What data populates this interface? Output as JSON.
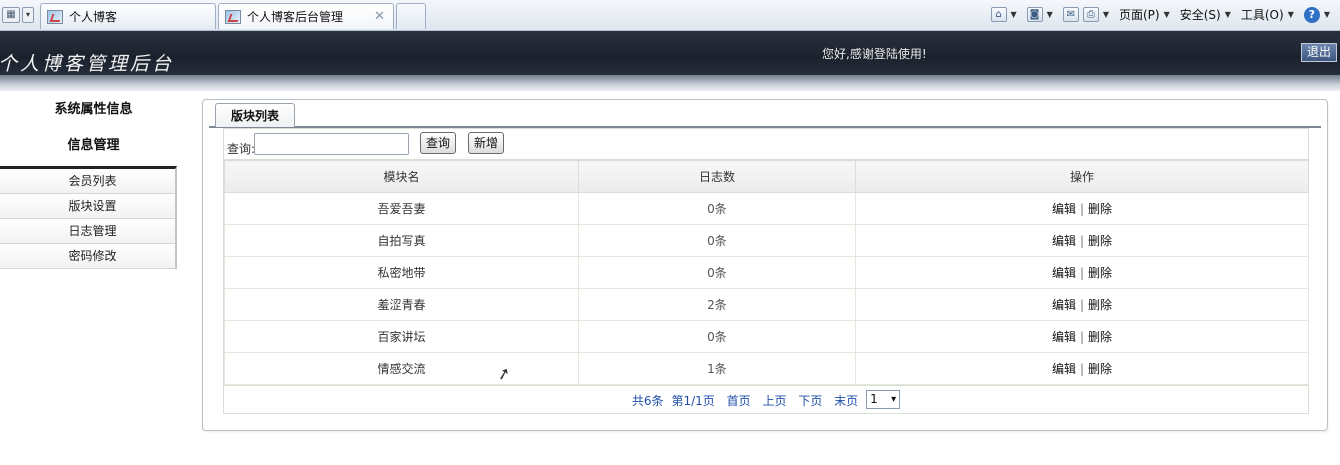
{
  "browser": {
    "tabs": [
      {
        "label": "个人博客",
        "active": false
      },
      {
        "label": "个人博客后台管理",
        "active": true
      },
      {
        "label": "",
        "active": false
      }
    ],
    "menus": {
      "page": "页面(P)",
      "safety": "安全(S)",
      "tools": "工具(O)"
    },
    "icons": [
      "home-icon",
      "feed-icon",
      "mail-icon",
      "print-icon",
      "help-icon"
    ]
  },
  "header": {
    "title": "个人博客管理后台",
    "welcome": "您好,感谢登陆使用!",
    "logout": "退出"
  },
  "sidebar": {
    "section1": "系统属性信息",
    "section2": "信息管理",
    "items": [
      {
        "label": "会员列表"
      },
      {
        "label": "版块设置"
      },
      {
        "label": "日志管理"
      },
      {
        "label": "密码修改"
      }
    ]
  },
  "panel": {
    "tab_label": "版块列表",
    "query_label": "查询:",
    "query_value": "",
    "search_button": "查询",
    "add_button": "新增"
  },
  "table": {
    "headers": [
      "模块名",
      "日志数",
      "操作"
    ],
    "rows": [
      {
        "name": "吾爱吾妻",
        "count": "0条",
        "edit": "编辑",
        "delete": "删除"
      },
      {
        "name": "自拍写真",
        "count": "0条",
        "edit": "编辑",
        "delete": "删除"
      },
      {
        "name": "私密地带",
        "count": "0条",
        "edit": "编辑",
        "delete": "删除"
      },
      {
        "name": "羞涩青春",
        "count": "2条",
        "edit": "编辑",
        "delete": "删除"
      },
      {
        "name": "百家讲坛",
        "count": "0条",
        "edit": "编辑",
        "delete": "删除"
      },
      {
        "name": "情感交流",
        "count": "1条",
        "edit": "编辑",
        "delete": "删除"
      }
    ]
  },
  "pager": {
    "total": "共6条",
    "page_info": "第1/1页",
    "first": "首页",
    "prev": "上页",
    "next": "下页",
    "last": "末页",
    "selected": "1"
  }
}
